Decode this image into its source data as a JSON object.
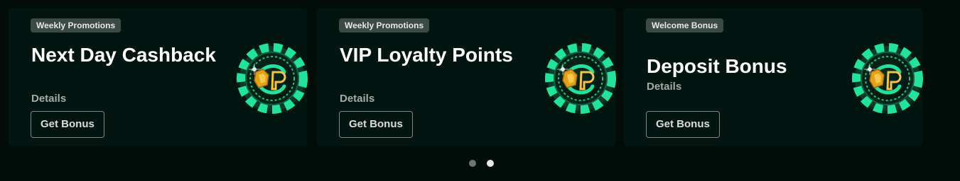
{
  "promotions": [
    {
      "badge": "Weekly Promotions",
      "title": "Next Day Cashback",
      "details": "Details",
      "button": "Get Bonus"
    },
    {
      "badge": "Weekly Promotions",
      "title": "VIP Loyalty Points",
      "details": "Details",
      "button": "Get Bonus"
    },
    {
      "badge": "Welcome Bonus",
      "title": "Deposit Bonus",
      "details": "Details",
      "button": "Get Bonus"
    }
  ],
  "carousel": {
    "page_count": 2,
    "active_page": 2
  },
  "icons": {
    "promo_image": "casino-chip-icon"
  },
  "colors": {
    "background": "#020d09",
    "card": "#031510",
    "chip_accent": "#23e39a",
    "badge": "#3c4a44"
  }
}
